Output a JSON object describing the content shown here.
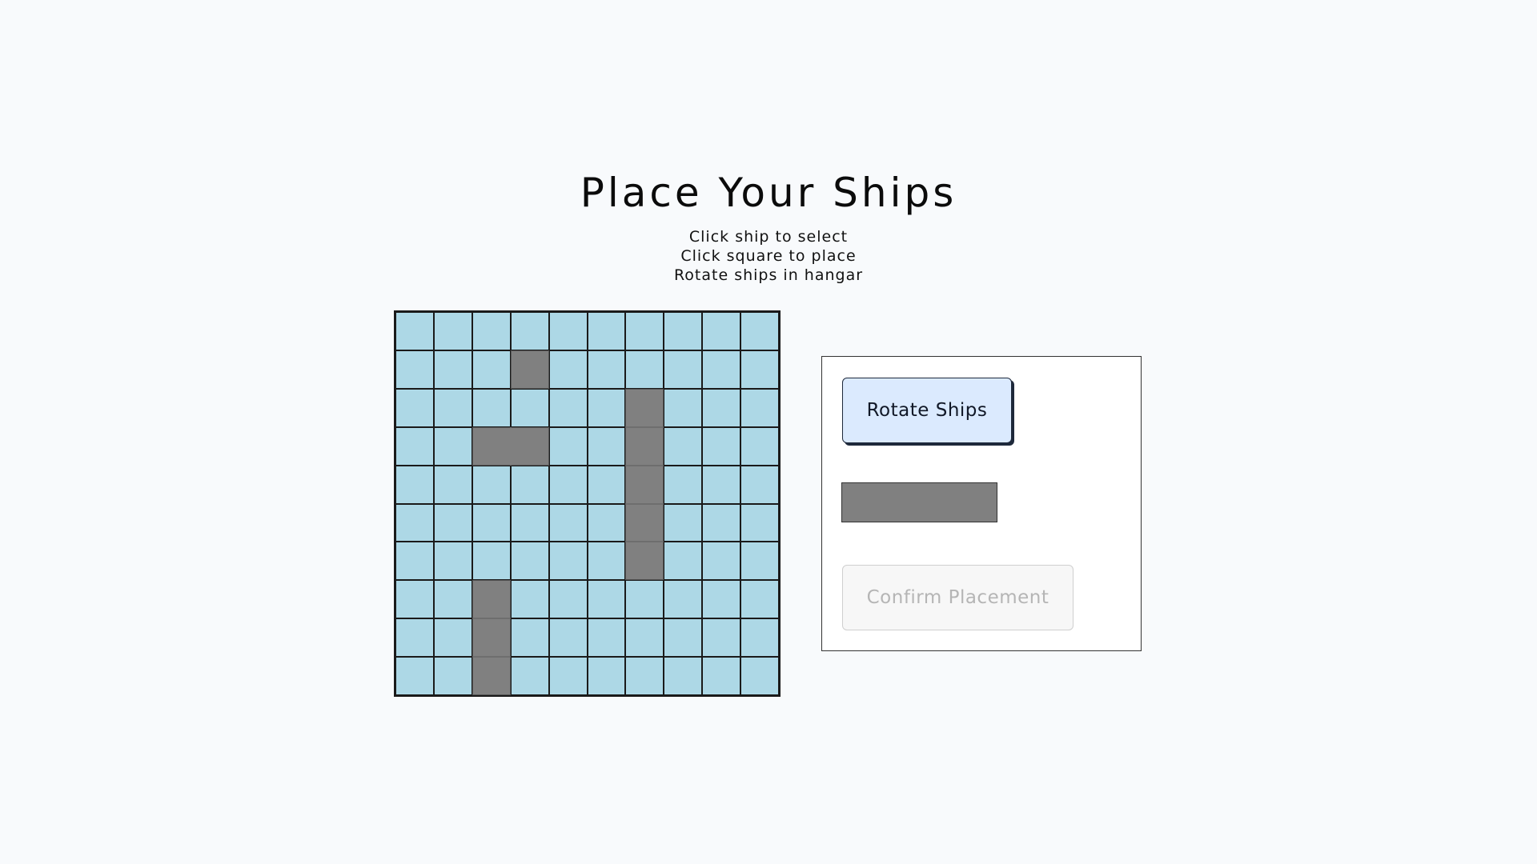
{
  "title": "Place Your Ships",
  "instructions": [
    "Click ship to select",
    "Click square to place",
    "Rotate ships in hangar"
  ],
  "board": {
    "rows": 10,
    "cols": 10,
    "ship_cells": [
      [
        1,
        3
      ],
      [
        2,
        6
      ],
      [
        3,
        2
      ],
      [
        3,
        3
      ],
      [
        3,
        6
      ],
      [
        4,
        6
      ],
      [
        5,
        6
      ],
      [
        6,
        6
      ],
      [
        7,
        2
      ],
      [
        8,
        2
      ],
      [
        9,
        2
      ]
    ],
    "water_color": "#add8e6",
    "ship_color": "#808080"
  },
  "hangar": {
    "rotate_label": "Rotate Ships",
    "remaining_ship_length": 4,
    "confirm_label": "Confirm Placement",
    "confirm_disabled": true
  },
  "colors": {
    "background": "#f8fafc",
    "rotate_button_bg": "#dbeafe",
    "confirm_button_text": "#b5b5b5"
  }
}
